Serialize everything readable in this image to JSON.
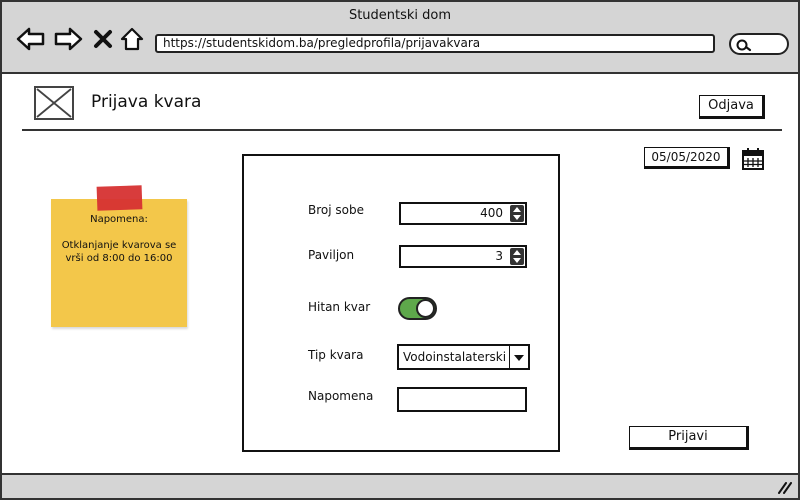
{
  "window": {
    "title": "Studentski dom"
  },
  "browser": {
    "url": "https://studentskidom.ba/pregledprofila/prijavakvara",
    "back_icon": "arrow-left-icon",
    "forward_icon": "arrow-right-icon",
    "close_icon": "close-icon",
    "home_icon": "home-icon",
    "search_icon": "search-icon"
  },
  "header": {
    "title": "Prijava kvara",
    "logout_label": "Odjava"
  },
  "date": {
    "value": "05/05/2020",
    "icon": "calendar-icon"
  },
  "note": {
    "title": "Napomena:",
    "text": "Otklanjanje kvarova se vrši od 8:00 do 16:00",
    "color": "#f3c74a",
    "tape_color": "#d63232"
  },
  "form": {
    "room_label": "Broj sobe",
    "room_value": "400",
    "pavilion_label": "Paviljon",
    "pavilion_value": "3",
    "urgent_label": "Hitan kvar",
    "urgent_on": true,
    "type_label": "Tip kvara",
    "type_value": "Vodoinstalaterski",
    "remark_label": "Napomena",
    "remark_value": "",
    "submit_label": "Prijavi"
  },
  "colors": {
    "toggle_on": "#5ea84b",
    "chrome": "#d5d5d5"
  }
}
